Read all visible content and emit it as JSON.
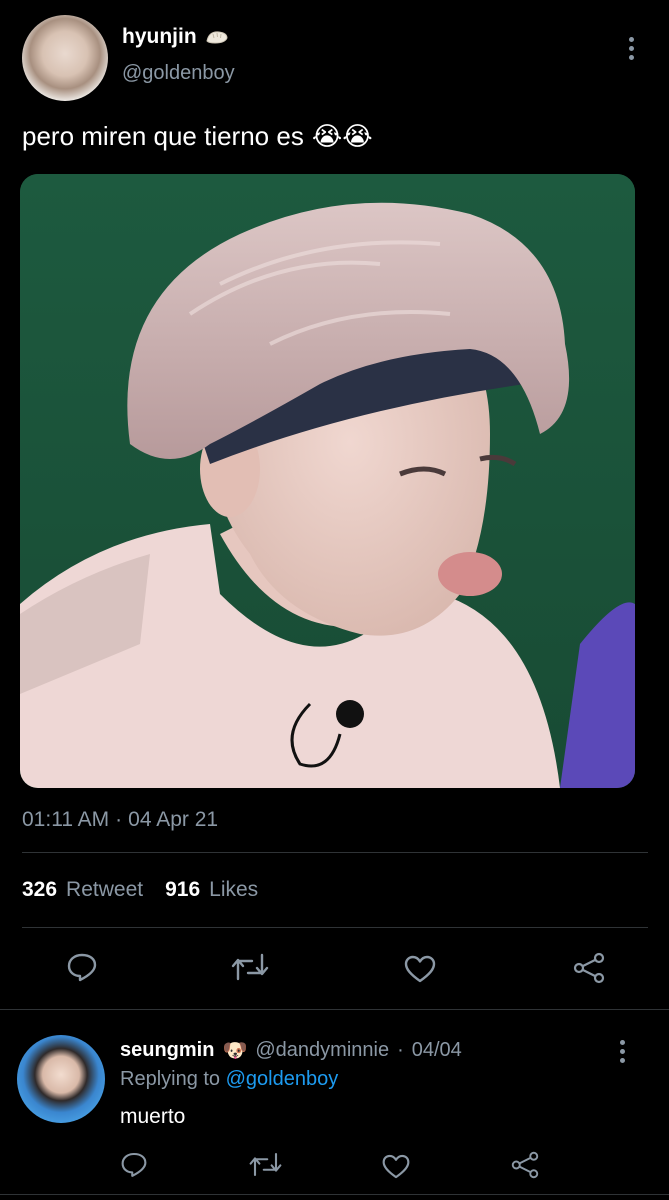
{
  "tweet": {
    "author_name": "hyunjin",
    "author_handle": "@goldenboy",
    "text": "pero miren que tierno es",
    "emoji": "😭😭",
    "time": "01:11 AM",
    "date_sep": "·",
    "date": "04 Apr 21",
    "retweets_count": "326",
    "retweets_label": "Retweet",
    "likes_count": "916",
    "likes_label": "Likes"
  },
  "reply": {
    "author_name": "seungmin",
    "author_emoji": "🐶",
    "author_handle": "@dandyminnie",
    "date_sep": "·",
    "date": "04/04",
    "replying_to_label": "Replying to",
    "replying_to_handle": "@goldenboy",
    "text": "muerto"
  },
  "icons": {
    "verified_badge": "dumpling-emoji-icon",
    "action_icons": [
      "reply-icon",
      "retweet-icon",
      "like-icon",
      "share-icon"
    ]
  },
  "colors": {
    "background": "#000000",
    "text": "#e7e9ea",
    "muted": "#8b98a5",
    "link": "#1d9bf0",
    "divider": "#2f3336"
  }
}
